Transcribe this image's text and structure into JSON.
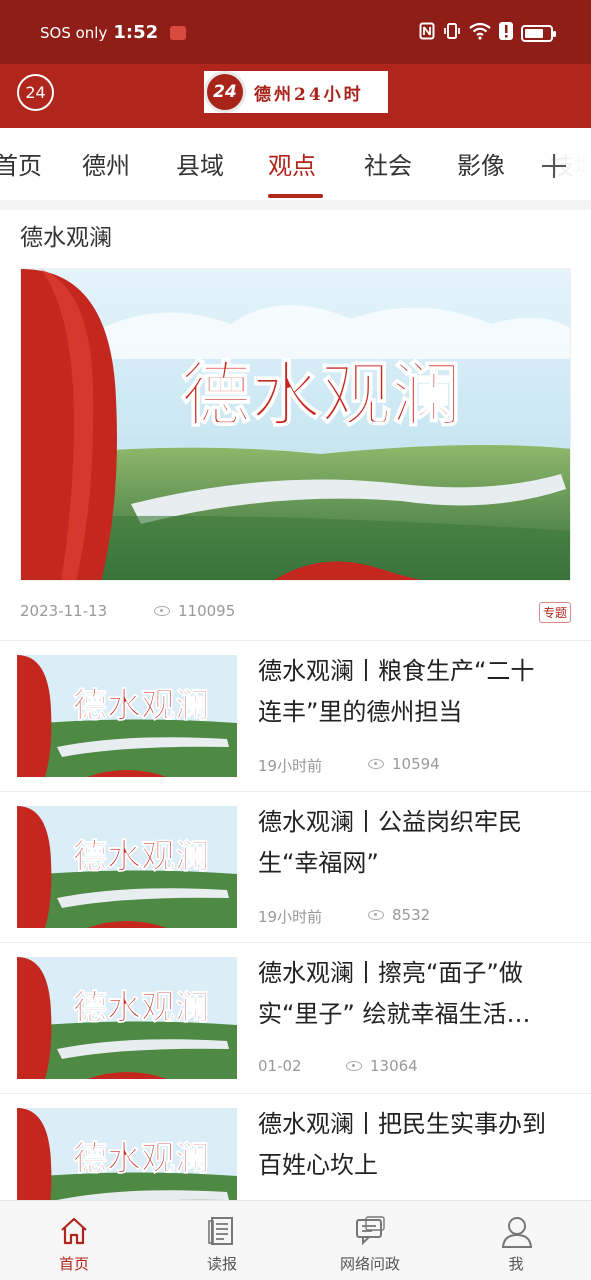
{
  "status_bar": {
    "carrier": "SOS only",
    "time": "1:52",
    "icons": [
      "nfc-icon",
      "vibrate-icon",
      "wifi-icon",
      "alert-icon",
      "battery-icon"
    ],
    "battery_level": 0.75
  },
  "header": {
    "left_logo": "24",
    "brand_mark": "24",
    "brand_name": "德州24小时"
  },
  "tabs": [
    {
      "label": "首页"
    },
    {
      "label": "德州"
    },
    {
      "label": "县域"
    },
    {
      "label": "观点",
      "active": true
    },
    {
      "label": "社会"
    },
    {
      "label": "影像"
    },
    {
      "label": "技城"
    }
  ],
  "section": {
    "title": "德水观澜",
    "hero": {
      "image_text": "德水观澜",
      "date": "2023-11-13",
      "views": "110095",
      "tag": "专题"
    }
  },
  "articles": [
    {
      "title": "德水观澜丨粮食生产“二十连丰”里的德州担当",
      "time": "19小时前",
      "views": "10594",
      "thumb_text": "德水观澜"
    },
    {
      "title": "德水观澜丨公益岗织牢民生“幸福网”",
      "time": "19小时前",
      "views": "8532",
      "thumb_text": "德水观澜"
    },
    {
      "title": "德水观澜丨擦亮“面子”做实“里子” 绘就幸福生活…",
      "time": "01-02",
      "views": "13064",
      "thumb_text": "德水观澜"
    },
    {
      "title": "德水观澜丨把民生实事办到百姓心坎上",
      "time": "",
      "views": "",
      "thumb_text": "德水观澜"
    }
  ],
  "bottom_nav": [
    {
      "label": "首页",
      "icon": "home-icon",
      "active": true
    },
    {
      "label": "读报",
      "icon": "newspaper-icon"
    },
    {
      "label": "网络问政",
      "icon": "chat-icon"
    },
    {
      "label": "我",
      "icon": "user-icon"
    }
  ],
  "colors": {
    "status_bar": "#8e1e17",
    "header": "#b1261c",
    "accent": "#b1261c"
  }
}
